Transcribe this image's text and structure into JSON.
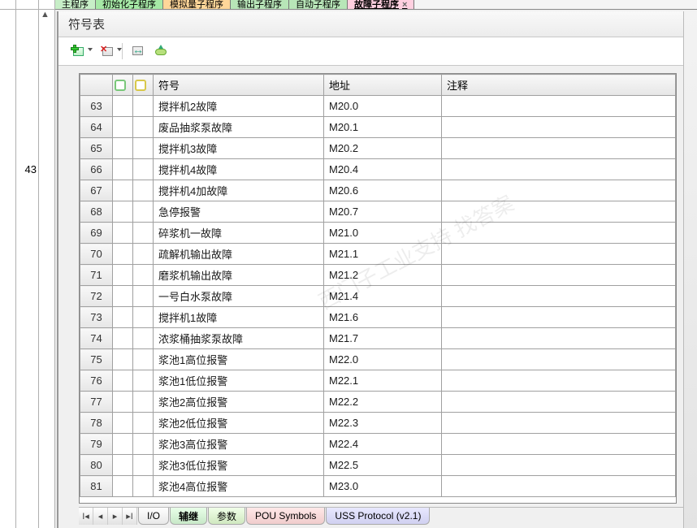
{
  "topTabs": [
    {
      "label": "主程序"
    },
    {
      "label": "初始化子程序"
    },
    {
      "label": "模拟量子程序"
    },
    {
      "label": "输出子程序"
    },
    {
      "label": "自动子程序"
    },
    {
      "label": "故障子程序"
    }
  ],
  "panelTitle": "符号表",
  "gutterLine": "43",
  "headers": {
    "symbol": "符号",
    "address": "地址",
    "comment": "注释"
  },
  "rows": [
    {
      "n": "63",
      "sym": "搅拌机2故障",
      "addr": "M20.0",
      "cmt": ""
    },
    {
      "n": "64",
      "sym": "废品抽浆泵故障",
      "addr": "M20.1",
      "cmt": ""
    },
    {
      "n": "65",
      "sym": "搅拌机3故障",
      "addr": "M20.2",
      "cmt": ""
    },
    {
      "n": "66",
      "sym": "搅拌机4故障",
      "addr": "M20.4",
      "cmt": ""
    },
    {
      "n": "67",
      "sym": "搅拌机4加故障",
      "addr": "M20.6",
      "cmt": ""
    },
    {
      "n": "68",
      "sym": "急停报警",
      "addr": "M20.7",
      "cmt": ""
    },
    {
      "n": "69",
      "sym": "碎浆机一故障",
      "addr": "M21.0",
      "cmt": ""
    },
    {
      "n": "70",
      "sym": "疏解机输出故障",
      "addr": "M21.1",
      "cmt": ""
    },
    {
      "n": "71",
      "sym": "磨浆机输出故障",
      "addr": "M21.2",
      "cmt": ""
    },
    {
      "n": "72",
      "sym": "一号白水泵故障",
      "addr": "M21.4",
      "cmt": ""
    },
    {
      "n": "73",
      "sym": "搅拌机1故障",
      "addr": "M21.6",
      "cmt": ""
    },
    {
      "n": "74",
      "sym": "浓浆桶抽浆泵故障",
      "addr": "M21.7",
      "cmt": ""
    },
    {
      "n": "75",
      "sym": "浆池1高位报警",
      "addr": "M22.0",
      "cmt": ""
    },
    {
      "n": "76",
      "sym": "浆池1低位报警",
      "addr": "M22.1",
      "cmt": ""
    },
    {
      "n": "77",
      "sym": "浆池2高位报警",
      "addr": "M22.2",
      "cmt": ""
    },
    {
      "n": "78",
      "sym": "浆池2低位报警",
      "addr": "M22.3",
      "cmt": ""
    },
    {
      "n": "79",
      "sym": "浆池3高位报警",
      "addr": "M22.4",
      "cmt": ""
    },
    {
      "n": "80",
      "sym": "浆池3低位报警",
      "addr": "M22.5",
      "cmt": ""
    },
    {
      "n": "81",
      "sym": "浆池4高位报警",
      "addr": "M23.0",
      "cmt": ""
    }
  ],
  "bottomTabs": [
    {
      "label": "I/O"
    },
    {
      "label": "辅继"
    },
    {
      "label": "参数"
    },
    {
      "label": "POU Symbols"
    },
    {
      "label": "USS Protocol (v2.1)"
    }
  ],
  "watermark": "西门子工业支持 找答案"
}
